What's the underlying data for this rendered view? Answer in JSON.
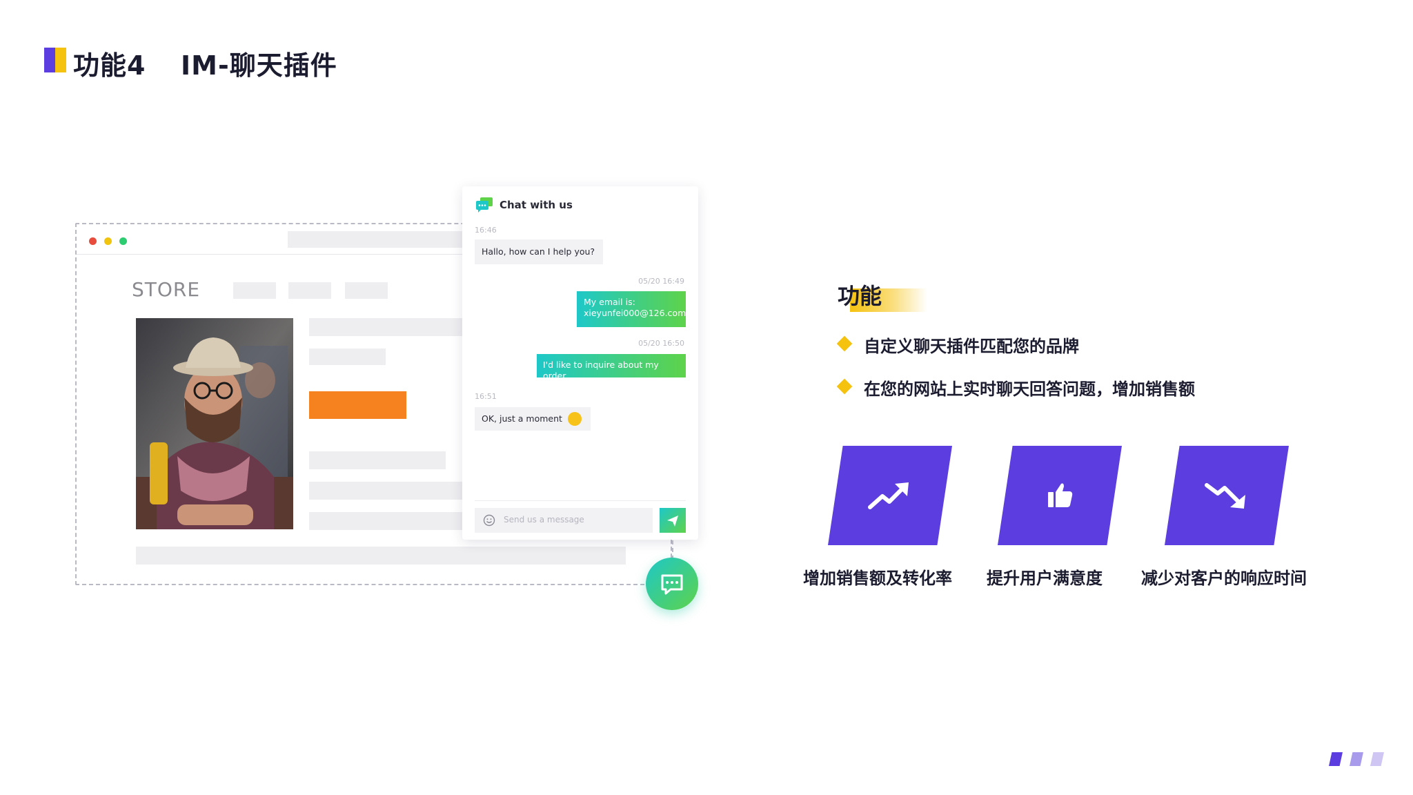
{
  "header": {
    "label": "功能4",
    "title": "IM-聊天插件"
  },
  "mockup": {
    "store_label": "STORE",
    "accent_color": "#f5821f",
    "photo_alt": "man-with-hat-and-scarf-photo"
  },
  "chat": {
    "title": "Chat with us",
    "messages": [
      {
        "from": "agent",
        "time": "16:46",
        "text": "Hallo, how can I help you?"
      },
      {
        "from": "user",
        "time": "05/20 16:49",
        "line1": "My email is:",
        "line2": "xieyunfei000@126.com"
      },
      {
        "from": "user",
        "time": "05/20 16:50",
        "text": "I'd like to inquire about my order"
      },
      {
        "from": "agent",
        "time": "16:51",
        "text": "OK, just a moment",
        "emoji": "smiley-icon"
      }
    ],
    "input_placeholder": "Send us a message",
    "brand_gradient": [
      "#1ec8c8",
      "#5ed34a"
    ]
  },
  "features": {
    "title": "功能",
    "items": [
      "自定义聊天插件匹配您的品牌",
      "在您的网站上实时聊天回答问题，增加销售额"
    ],
    "cards": [
      {
        "icon": "trend-up-icon",
        "label": "增加销售额及转化率"
      },
      {
        "icon": "thumbs-up-icon",
        "label": "提升用户满意度"
      },
      {
        "icon": "trend-down-icon",
        "label": "减少对客户的响应时间"
      }
    ]
  },
  "colors": {
    "primary": "#5b3de0",
    "highlight": "#f5c20f",
    "text": "#1c1c30"
  }
}
